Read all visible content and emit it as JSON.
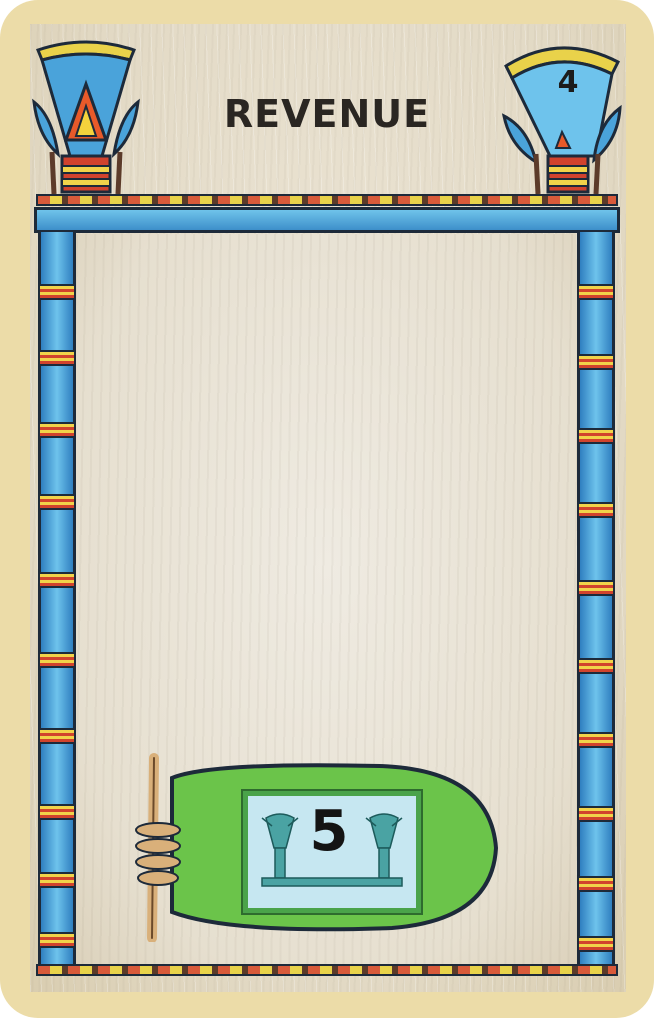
{
  "card": {
    "title": "REVENUE",
    "cost": "4",
    "revenue_value": "5",
    "icons": {
      "corner_left": "lotus-capital-icon",
      "corner_right": "lotus-capital-icon",
      "bag": "money-bag-icon",
      "value_panel": "papyrus-pillars-icon"
    },
    "colors": {
      "card_border": "#ecdca8",
      "pillar_blue": "#4aa3da",
      "band_red": "#d1432d",
      "band_yellow": "#f1d34a",
      "bag_green": "#6bc44a",
      "panel_blue": "#c6e7f1"
    }
  }
}
